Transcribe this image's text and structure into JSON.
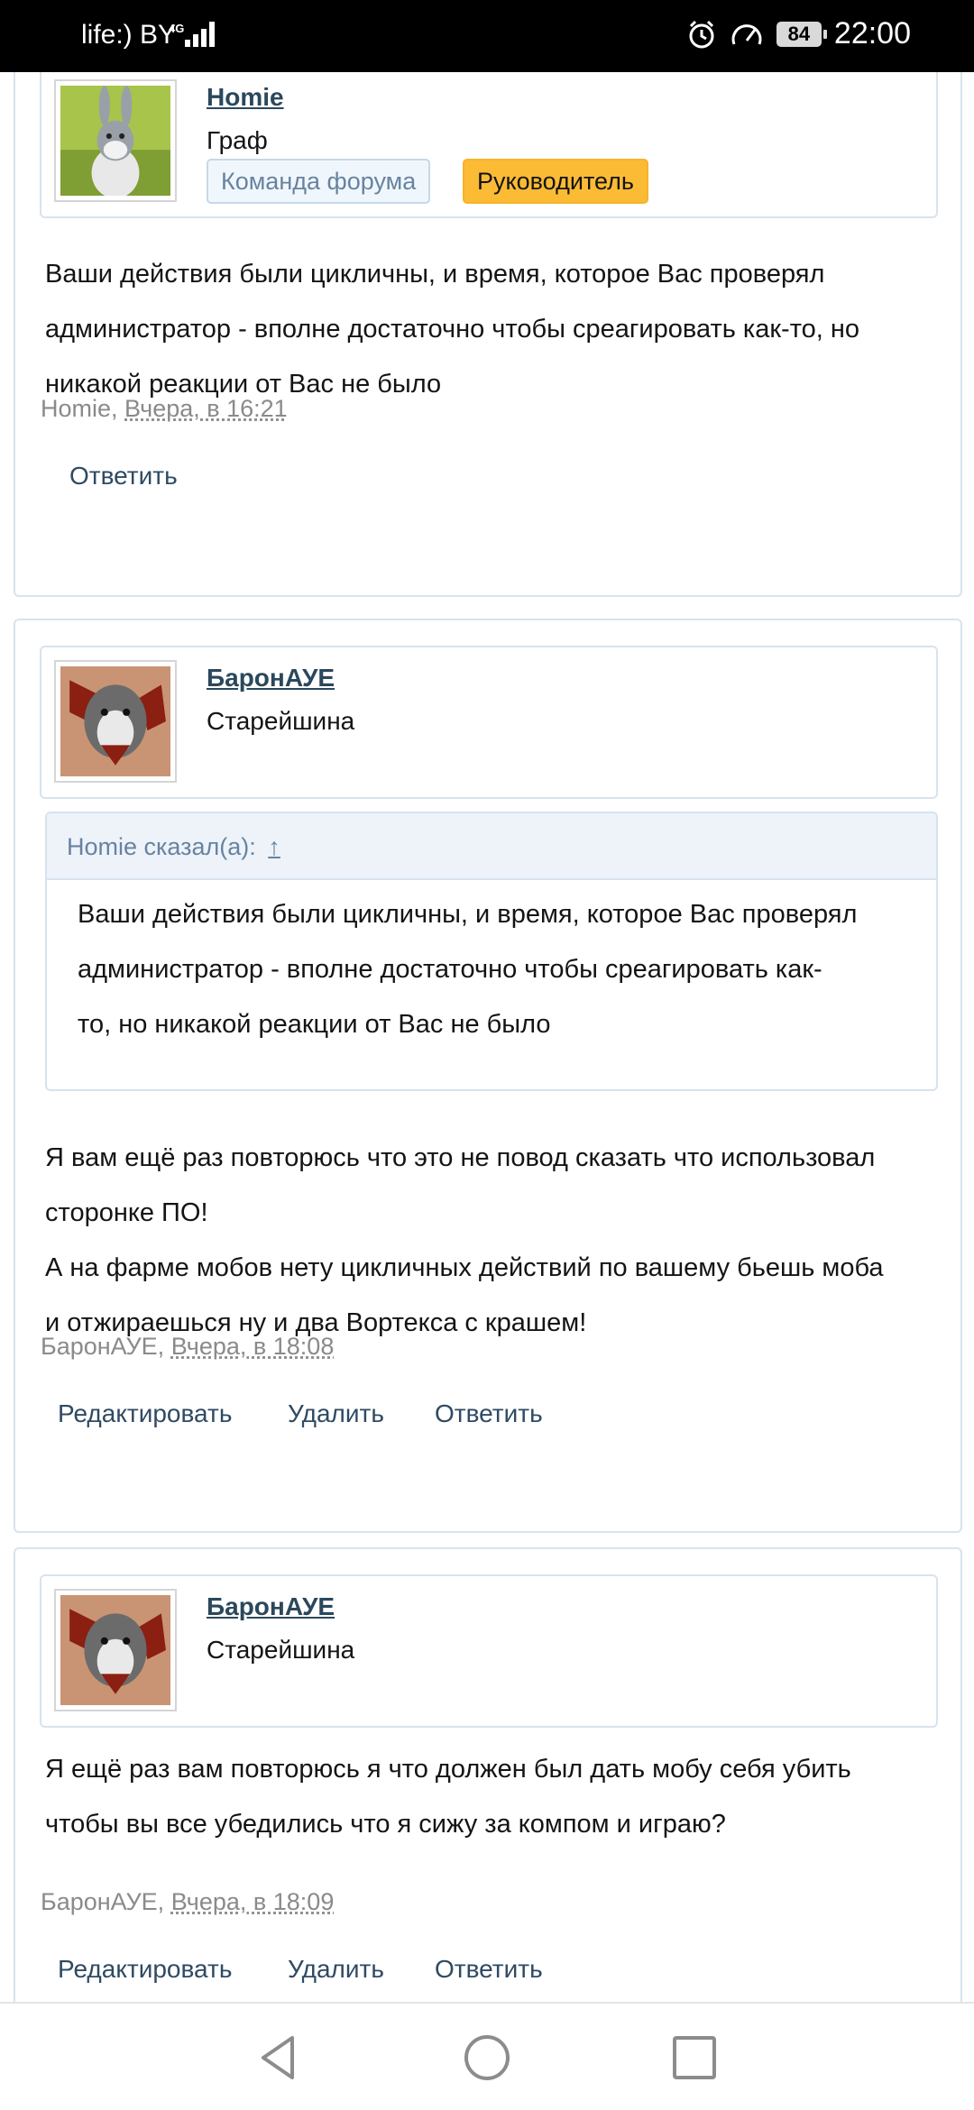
{
  "status_bar": {
    "carrier": "life:) BY",
    "network": "4G",
    "battery": "84",
    "time": "22:00",
    "icons": [
      "alarm-icon",
      "data-saver-icon",
      "battery-icon",
      "signal-icon"
    ]
  },
  "posts": [
    {
      "username": "Homie",
      "user_title": "Граф",
      "banners": [
        "Команда форума",
        "Руководитель"
      ],
      "message_lines": [
        "Ваши действия были цикличны, и время, которое Вас проверял",
        "администратор - вполне достаточно чтобы среагировать как-то, но",
        "никакой реакции от Вас не было"
      ],
      "author": "Homie",
      "date": "Вчера, в 16:21",
      "actions": [
        "Ответить"
      ]
    },
    {
      "username": "БаронАУЕ",
      "user_title": "Старейшина",
      "quote": {
        "header": "Homie сказал(а):",
        "link": "↑",
        "lines": [
          "Ваши действия были цикличны, и время, которое Вас проверял",
          "администратор - вполне достаточно чтобы среагировать как-",
          "то, но никакой реакции от Вас не было"
        ]
      },
      "message_lines": [
        "Я вам ещё раз повторюсь что это не повод сказать что использовал",
        "сторонке ПО!",
        "А на фарме мобов нету цикличных действий по вашему бьешь моба",
        "и отжираешься ну и два Вортекса с крашем!"
      ],
      "author": "БаронАУЕ",
      "date": "Вчера, в 18:08",
      "actions": [
        "Редактировать",
        "Удалить",
        "Ответить"
      ]
    },
    {
      "username": "БаронАУЕ",
      "user_title": "Старейшина",
      "message_lines": [
        "Я ещё раз вам повторюсь я что должен был дать мобу себя убить",
        "чтобы вы все убедились что я сижу за компом и играю?"
      ],
      "author": "БаронАУЕ",
      "date": "Вчера, в 18:09",
      "actions": [
        "Редактировать",
        "Удалить",
        "Ответить"
      ]
    }
  ],
  "nav_bar": {
    "icons": [
      "back-icon",
      "home-icon",
      "recents-icon"
    ]
  }
}
